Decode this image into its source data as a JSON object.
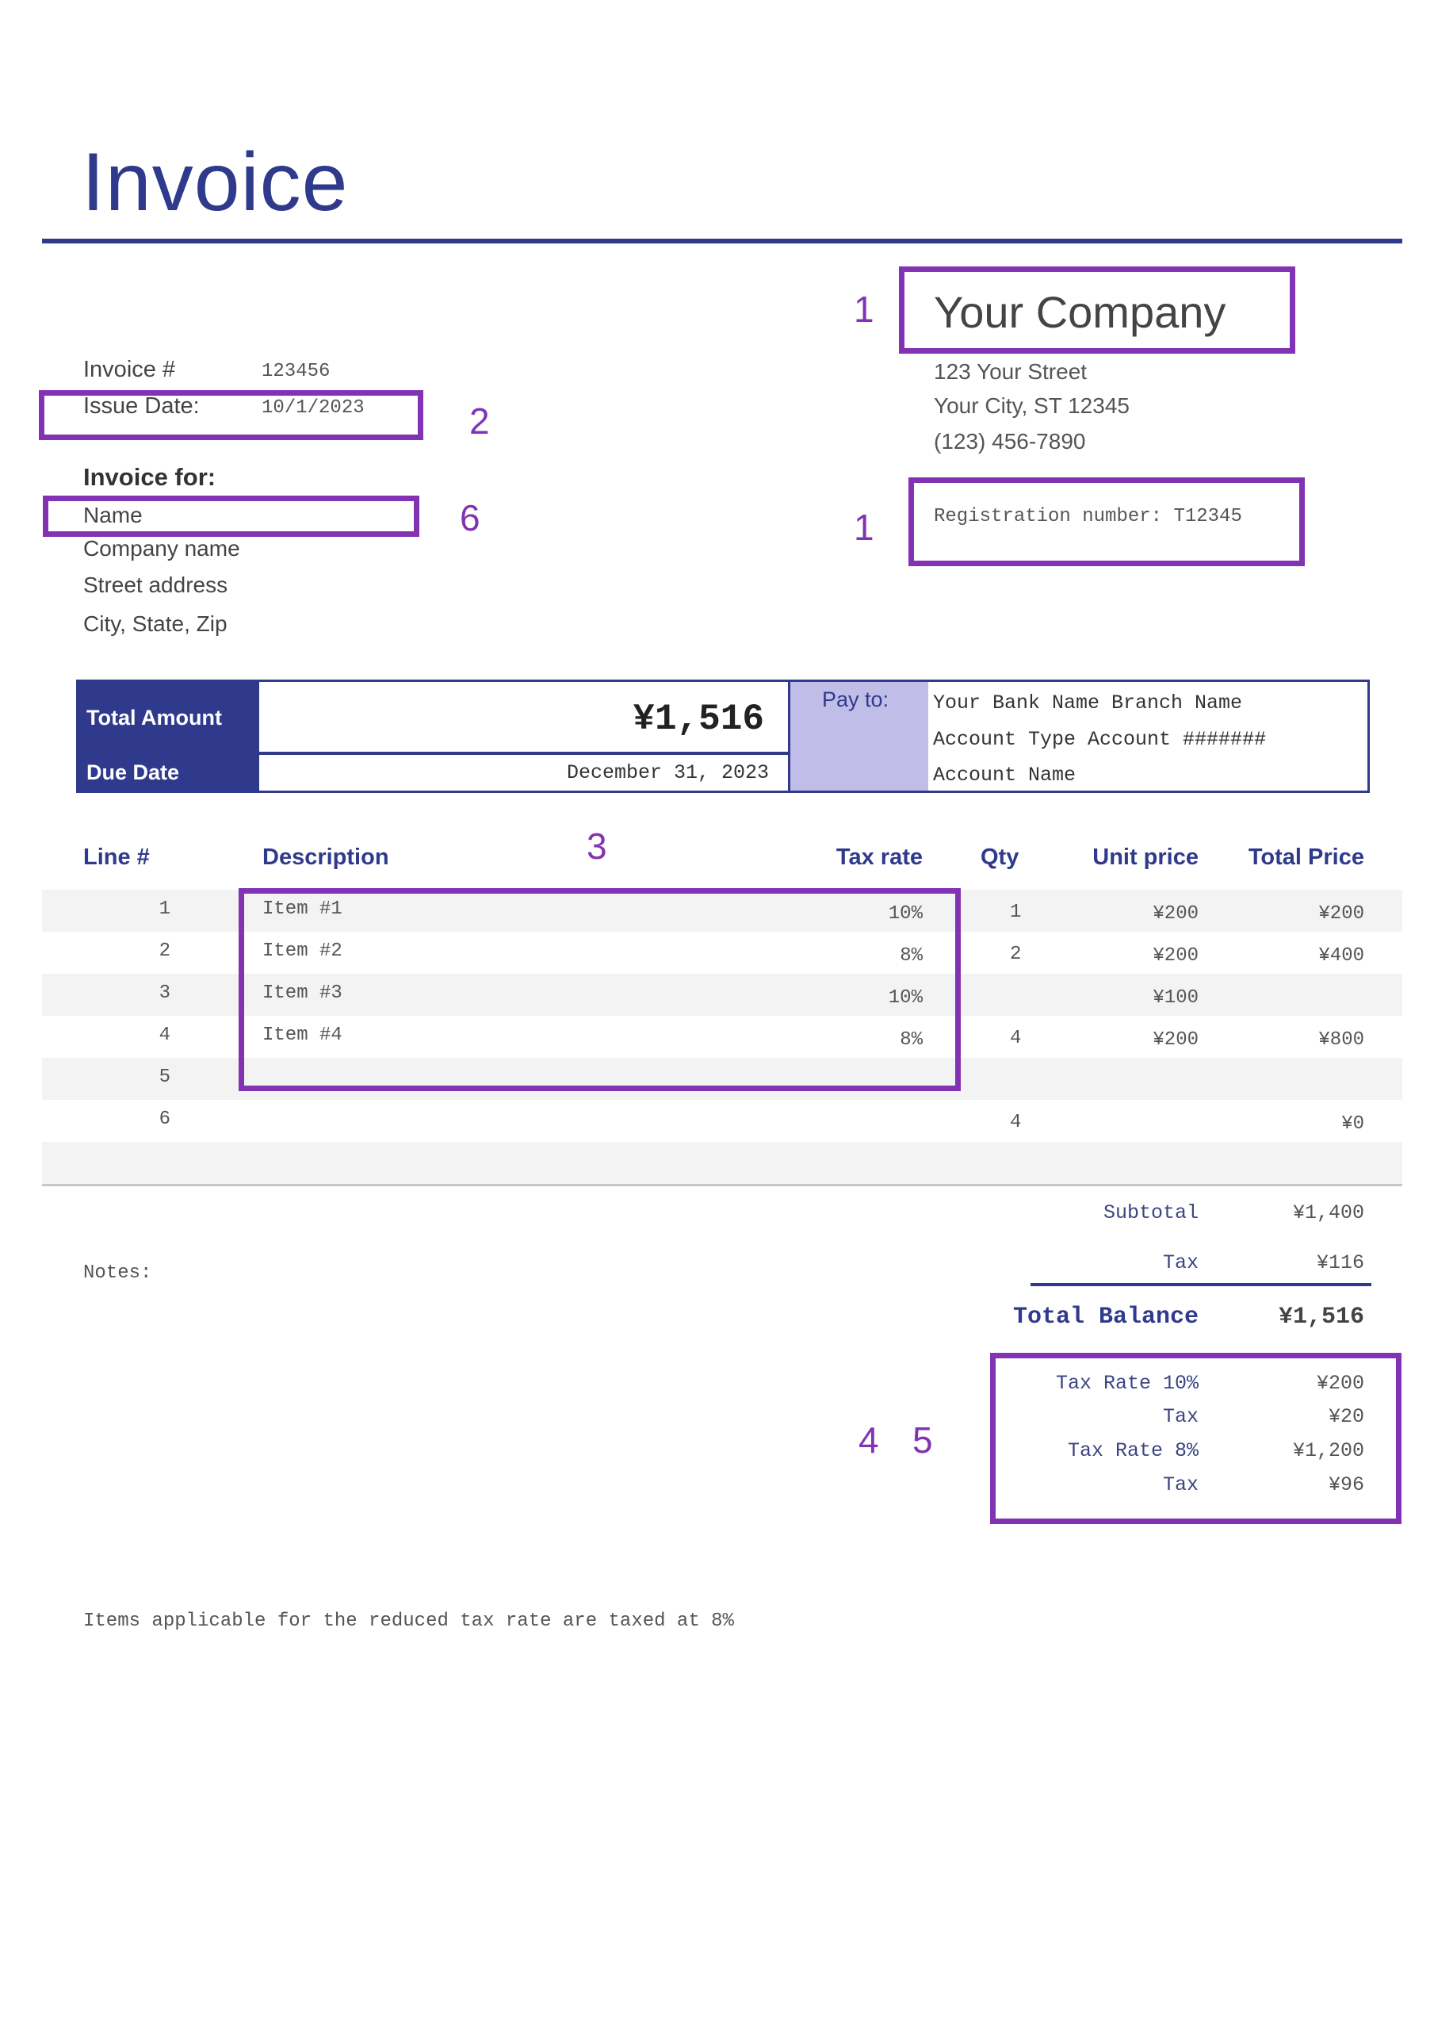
{
  "title": "Invoice",
  "invoice_meta": {
    "invoice_number_label": "Invoice #",
    "invoice_number": "123456",
    "issue_date_label": "Issue Date:",
    "issue_date": "10/1/2023"
  },
  "client": {
    "heading": "Invoice for:",
    "name": "Name",
    "company": "Company name",
    "street": "Street address",
    "city_state_zip": "City, State, Zip"
  },
  "company": {
    "name": "Your Company",
    "street": "123 Your Street",
    "city": "Your City, ST 12345",
    "phone": "(123) 456-7890",
    "registration": "Registration number: T12345"
  },
  "summary": {
    "total_amount_label": "Total Amount",
    "total_amount": "¥1,516",
    "due_date_label": "Due Date",
    "due_date": "December 31, 2023",
    "pay_to_label": "Pay to:",
    "bank_lines": [
      "Your Bank Name Branch Name",
      "Account Type Account #######",
      "Account Name"
    ]
  },
  "table": {
    "headers": {
      "line": "Line #",
      "description": "Description",
      "tax_rate": "Tax rate",
      "qty": "Qty",
      "unit_price": "Unit price",
      "total_price": "Total Price"
    },
    "rows": [
      {
        "line": "1",
        "description": "Item #1",
        "tax_rate": "10%",
        "qty": "1",
        "unit_price": "¥200",
        "total_price": "¥200"
      },
      {
        "line": "2",
        "description": "Item #2",
        "tax_rate": "8%",
        "qty": "2",
        "unit_price": "¥200",
        "total_price": "¥400"
      },
      {
        "line": "3",
        "description": "Item #3",
        "tax_rate": "10%",
        "qty": "",
        "unit_price": "¥100",
        "total_price": ""
      },
      {
        "line": "4",
        "description": "Item #4",
        "tax_rate": "8%",
        "qty": "4",
        "unit_price": "¥200",
        "total_price": "¥800"
      },
      {
        "line": "5",
        "description": "",
        "tax_rate": "",
        "qty": "",
        "unit_price": "",
        "total_price": ""
      },
      {
        "line": "6",
        "description": "",
        "tax_rate": "",
        "qty": "4",
        "unit_price": "",
        "total_price": "¥0"
      },
      {
        "line": "",
        "description": "",
        "tax_rate": "",
        "qty": "",
        "unit_price": "",
        "total_price": ""
      }
    ]
  },
  "totals": {
    "subtotal_label": "Subtotal",
    "subtotal": "¥1,400",
    "tax_label": "Tax",
    "tax": "¥116",
    "total_balance_label": "Total Balance",
    "total_balance": "¥1,516",
    "breakdown": [
      {
        "label": "Tax Rate 10%",
        "value": "¥200"
      },
      {
        "label": "Tax",
        "value": "¥20"
      },
      {
        "label": "Tax Rate 8%",
        "value": "¥1,200"
      },
      {
        "label": "Tax",
        "value": "¥96"
      }
    ]
  },
  "notes_label": "Notes:",
  "footer_note": "Items applicable for the reduced tax rate are taxed at 8%",
  "annotations": {
    "company_name": "1",
    "registration": "1",
    "issue_date": "2",
    "line_items": "3",
    "tax_breakdown_a": "4",
    "tax_breakdown_b": "5",
    "client_name": "6"
  },
  "colors": {
    "brand_navy": "#2f3a8c",
    "annotation_purple": "#8233b4",
    "pay_to_fill": "#c0bde8",
    "row_shade": "#f3f3f3"
  }
}
